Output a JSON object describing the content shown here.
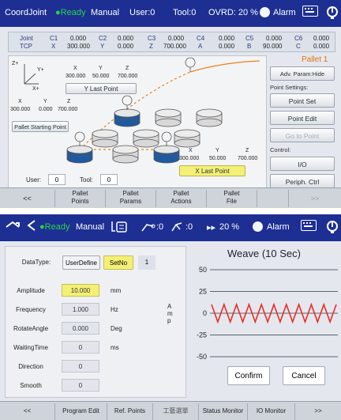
{
  "top_panel": {
    "status": {
      "mode": "CoordJoint",
      "state": "Ready",
      "run_mode": "Manual",
      "user": "User:0",
      "tool": "Tool:0",
      "ovrd": "OVRD: 20 %",
      "alarm": "Alarm",
      "icons": [
        "alarm-lamp-icon",
        "keyboard-icon",
        "power-icon"
      ]
    },
    "coords": {
      "row1_label": "Joint",
      "row2_label": "TCP",
      "cols": [
        {
          "h1": "C1",
          "v1": "0.000",
          "h2": "X",
          "v2": "300.000"
        },
        {
          "h1": "C2",
          "v1": "0.000",
          "h2": "Y",
          "v2": "0.000"
        },
        {
          "h1": "C3",
          "v1": "0.000",
          "h2": "Z",
          "v2": "700.000"
        },
        {
          "h1": "C4",
          "v1": "0.000",
          "h2": "A",
          "v2": "0.000"
        },
        {
          "h1": "C5",
          "v1": "0.000",
          "h2": "B",
          "v2": "90.000"
        },
        {
          "h1": "C6",
          "v1": "0.000",
          "h2": "C",
          "v2": "0.000"
        }
      ]
    },
    "axis": {
      "z": "Z+",
      "y": "Y+",
      "x": "X+"
    },
    "y_last": {
      "hx": "X",
      "hy": "Y",
      "hz": "Z",
      "vx": "300.000",
      "vy": "50.000",
      "vz": "700.000",
      "button": "Y Last Point"
    },
    "start": {
      "hx": "X",
      "hy": "Y",
      "hz": "Z",
      "vx": "300.000",
      "vy": "0.000",
      "vz": "700.000",
      "button": "Pallet Starting Point"
    },
    "x_last": {
      "hx": "X",
      "hy": "Y",
      "hz": "Z",
      "vx": "300.000",
      "vy": "50.000",
      "vz": "700.000",
      "button": "X Last Point"
    },
    "user_label": "User:",
    "user_value": "0",
    "tool_label": "Tool:",
    "tool_value": "0",
    "right": {
      "title": "Pallet 1",
      "adv_button": "Adv. Param:Hide",
      "settings_label": "Point Settings:",
      "point_set": "Point Set",
      "point_edit": "Point Edit",
      "go_to_point": "Go to Point",
      "control_label": "Control:",
      "io": "I/O",
      "periph": "Periph. Ctrl"
    },
    "tabs": {
      "prev": "<<",
      "t1a": "Pallet",
      "t1b": "Points",
      "t2a": "Pallet",
      "t2b": "Params",
      "t3a": "Pallet",
      "t3b": "Actions",
      "t4a": "Pallet",
      "t4b": "File",
      "next": ">>"
    }
  },
  "bottom_panel": {
    "status": {
      "state": "Ready",
      "run_mode": "Manual",
      "counter1": ":0",
      "counter2": ":0",
      "speed": "20 %",
      "alarm": "Alarm",
      "icons": [
        "undo-icon",
        "back-icon",
        "list-icon",
        "link-icon",
        "robot-arm-icon",
        "fast-forward-icon",
        "alarm-lamp-icon",
        "keyboard-icon",
        "power-icon"
      ]
    },
    "datatype_label": "DataType:",
    "datatype_option1": "UserDefine",
    "datatype_option2": "SetNo",
    "set_number": "1",
    "params": [
      {
        "label": "Amplitude",
        "value": "10.000",
        "unit": "mm"
      },
      {
        "label": "Frequency",
        "value": "1.000",
        "unit": "Hz"
      },
      {
        "label": "RotateAngle",
        "value": "0.000",
        "unit": "Deg"
      },
      {
        "label": "WaitingTime",
        "value": "0",
        "unit": "ms"
      },
      {
        "label": "Direction",
        "value": "0",
        "unit": ""
      },
      {
        "label": "Smooth",
        "value": "0",
        "unit": ""
      }
    ],
    "chart_title": "Weave (10 Sec)",
    "amp_label": [
      "A",
      "m",
      "p"
    ],
    "confirm": "Confirm",
    "cancel": "Cancel",
    "tabs": {
      "prev": "<<",
      "t1": "Program Edit",
      "t2": "Ref. Points",
      "t3": "工藝選單",
      "t4": "Status Monitor",
      "t5": "IO Monitor",
      "next": ">>"
    },
    "colors": {
      "wave": "#ee2a22",
      "highlight": "#f3f076",
      "statusbar": "#1d2f93"
    }
  },
  "chart_data": {
    "type": "line",
    "title": "Weave (10 Sec)",
    "xlabel": "",
    "ylabel": "Amp",
    "ylim": [
      -50,
      50
    ],
    "yticks": [
      50,
      25,
      0,
      -25,
      -50
    ],
    "series": [
      {
        "amplitude": 10,
        "cycles": 10
      }
    ],
    "grid": true
  }
}
